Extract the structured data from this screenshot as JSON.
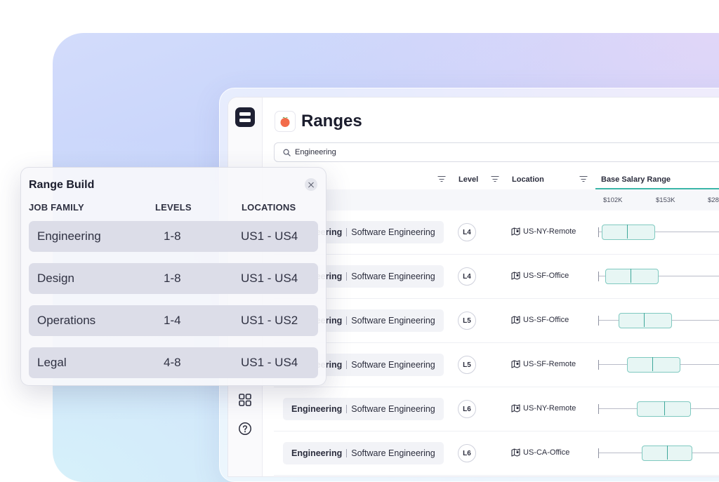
{
  "app": {
    "title": "Ranges",
    "search": {
      "value": "Engineering"
    }
  },
  "table": {
    "columns": {
      "level": "Level",
      "location": "Location",
      "salary": "Base Salary Range"
    },
    "ticks": [
      "$102K",
      "$153K",
      "$28"
    ],
    "rows": [
      {
        "family": "Engineering",
        "role": "Software Engineering",
        "level": "L4",
        "location": "US-NY-Remote",
        "range": [
          0.02,
          0.33
        ],
        "median": 0.17
      },
      {
        "family": "Engineering",
        "role": "Software Engineering",
        "level": "L4",
        "location": "US-SF-Office",
        "range": [
          0.04,
          0.35
        ],
        "median": 0.19
      },
      {
        "family": "Engineering",
        "role": "Software Engineering",
        "level": "L5",
        "location": "US-SF-Office",
        "range": [
          0.12,
          0.43
        ],
        "median": 0.27
      },
      {
        "family": "Engineering",
        "role": "Software Engineering",
        "level": "L5",
        "location": "US-SF-Remote",
        "range": [
          0.17,
          0.48
        ],
        "median": 0.32
      },
      {
        "family": "Engineering",
        "role": "Software Engineering",
        "level": "L6",
        "location": "US-NY-Remote",
        "range": [
          0.23,
          0.54
        ],
        "median": 0.39
      },
      {
        "family": "Engineering",
        "role": "Software Engineering",
        "level": "L6",
        "location": "US-CA-Office",
        "range": [
          0.26,
          0.55
        ],
        "median": 0.41
      }
    ]
  },
  "popover": {
    "title": "Range Build",
    "headers": {
      "family": "JOB FAMILY",
      "levels": "LEVELS",
      "locations": "LOCATIONS"
    },
    "rows": [
      {
        "family": "Engineering",
        "levels": "1-8",
        "locations": "US1 - US4"
      },
      {
        "family": "Design",
        "levels": "1-8",
        "locations": "US1 - US4"
      },
      {
        "family": "Operations",
        "levels": "1-4",
        "locations": "US1 - US2"
      },
      {
        "family": "Legal",
        "levels": "4-8",
        "locations": "US1 - US4"
      }
    ]
  },
  "colors": {
    "accent": "#3bb6a8",
    "brand": "#1e2033",
    "range_fill": "#e7f6f4"
  },
  "icons": {
    "logo": "stacked-bars-logo",
    "app": "peach-icon",
    "search": "search-icon",
    "filter": "filter-icon",
    "location": "map-pin-icon",
    "grid": "grid-icon",
    "help": "help-icon",
    "close": "close-icon"
  }
}
